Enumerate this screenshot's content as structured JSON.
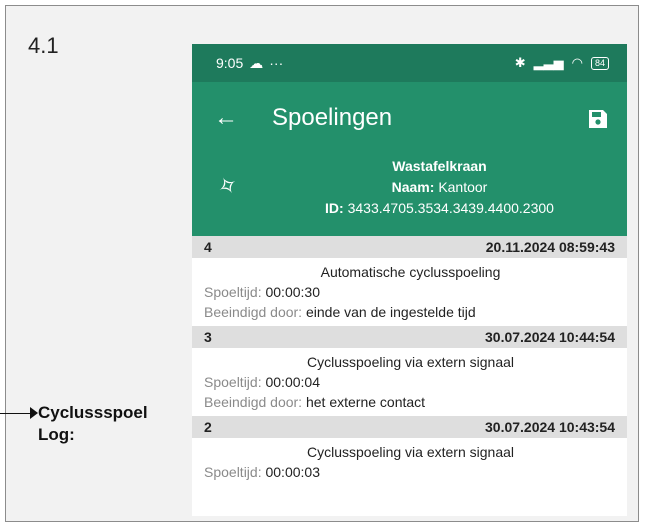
{
  "section_number": "4.1",
  "callout": {
    "line1": "Cyclussspoel",
    "line2": "Log:"
  },
  "status_bar": {
    "time": "9:05",
    "battery": "84"
  },
  "app_bar": {
    "title": "Spoelingen"
  },
  "device": {
    "name": "Wastafelkraan",
    "naam_label": "Naam:",
    "naam_value": "Kantoor",
    "id_label": "ID:",
    "id_value": "3433.4705.3534.3439.4400.2300"
  },
  "labels": {
    "duration": "Spoeltijd:",
    "ended_by": "Beeindigd door:"
  },
  "entries": [
    {
      "number": "4",
      "datetime": "20.11.2024 08:59:43",
      "type": "Automatische cyclusspoeling",
      "duration": "00:00:30",
      "ended_by": "einde van de ingestelde tijd"
    },
    {
      "number": "3",
      "datetime": "30.07.2024 10:44:54",
      "type": "Cyclusspoeling via extern signaal",
      "duration": "00:00:04",
      "ended_by": "het externe contact"
    },
    {
      "number": "2",
      "datetime": "30.07.2024 10:43:54",
      "type": "Cyclusspoeling via extern signaal",
      "duration": "00:00:03",
      "ended_by": ""
    }
  ],
  "colors": {
    "status_bar": "#1e7a5c",
    "header": "#23906b",
    "entry_head": "#dedede"
  }
}
